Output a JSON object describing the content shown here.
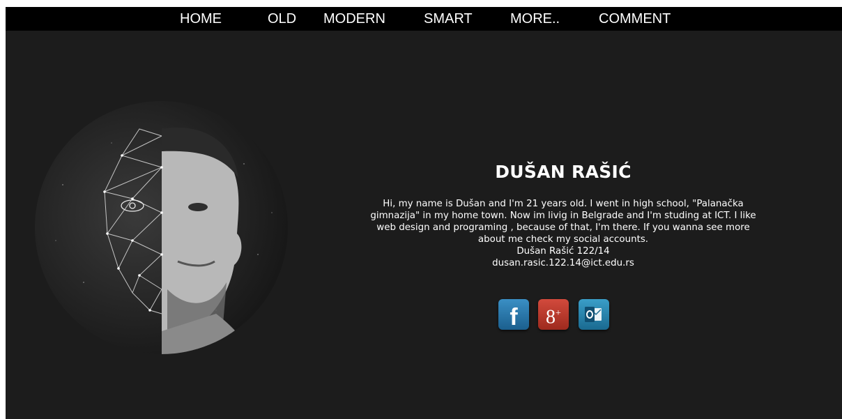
{
  "nav": {
    "items": [
      {
        "label": "HOME"
      },
      {
        "label": "OLD"
      },
      {
        "label": "MODERN"
      },
      {
        "label": "SMART"
      },
      {
        "label": "MORE.."
      },
      {
        "label": "COMMENT"
      }
    ]
  },
  "profile": {
    "name": "DUŠAN RAŠIĆ",
    "bio_lines": [
      "Hi, my name is Dušan and I'm 21 years old. I went in high school, \"Palanačka",
      "gimnazija\" in my home town. Now im livig in Belgrade and I'm studing at ICT. I like",
      "web design and programing , because of that, I'm there. If you wanna see more",
      "about me check my social accounts."
    ],
    "signature": "Dušan Rašić 122/14",
    "email": "dusan.rasic.122.14@ict.edu.rs"
  },
  "social": {
    "facebook_glyph": "f",
    "googleplus_glyph": "8",
    "googleplus_sup": "+",
    "icons": [
      "facebook-icon",
      "google-plus-icon",
      "outlook-icon"
    ]
  },
  "colors": {
    "background": "#1c1c1c",
    "navbar": "#000000",
    "text": "#ffffff",
    "facebook": "#1b5f8e",
    "googleplus": "#b0332a",
    "outlook": "#1a6a90"
  }
}
